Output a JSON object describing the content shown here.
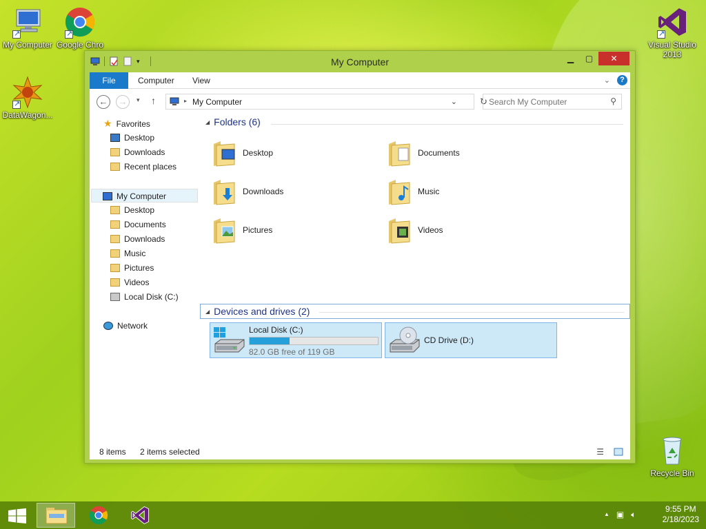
{
  "desktop": {
    "icons": [
      {
        "label": "My Computer",
        "icon": "computer-icon"
      },
      {
        "label": "Google Chro",
        "icon": "chrome-icon"
      },
      {
        "label": "DataWagon...",
        "icon": "datawagon-icon"
      },
      {
        "label": "Visual Studio 2013",
        "icon": "visual-studio-icon"
      },
      {
        "label": "Recycle Bin",
        "icon": "recycle-bin-icon"
      }
    ]
  },
  "window": {
    "title": "My Computer",
    "ribbon_tabs": [
      "File",
      "Computer",
      "View"
    ],
    "address": "My Computer",
    "search_placeholder": "Search My Computer",
    "nav_pane": {
      "favorites": {
        "label": "Favorites",
        "items": [
          "Desktop",
          "Downloads",
          "Recent places"
        ]
      },
      "computer": {
        "label": "My Computer",
        "items": [
          "Desktop",
          "Documents",
          "Downloads",
          "Music",
          "Pictures",
          "Videos",
          "Local Disk (C:)"
        ]
      },
      "network": {
        "label": "Network"
      }
    },
    "folders_group": {
      "header": "Folders (6)",
      "items": [
        "Desktop",
        "Documents",
        "Downloads",
        "Music",
        "Pictures",
        "Videos"
      ]
    },
    "drives_group": {
      "header": "Devices and drives (2)",
      "drives": [
        {
          "name": "Local Disk (C:)",
          "free_text": "82.0 GB free of 119 GB",
          "used_fraction": 0.31
        },
        {
          "name": "CD Drive (D:)"
        }
      ]
    },
    "status": {
      "items": "8 items",
      "selected": "2 items selected"
    }
  },
  "taskbar": {
    "time": "9:55 PM",
    "date": "2/18/2023"
  },
  "colors": {
    "accent": "#1979ca",
    "selection": "#cde8f7",
    "close_button": "#c7302b",
    "window_frame": "#aed04a",
    "progress_fill": "#26a0da"
  }
}
